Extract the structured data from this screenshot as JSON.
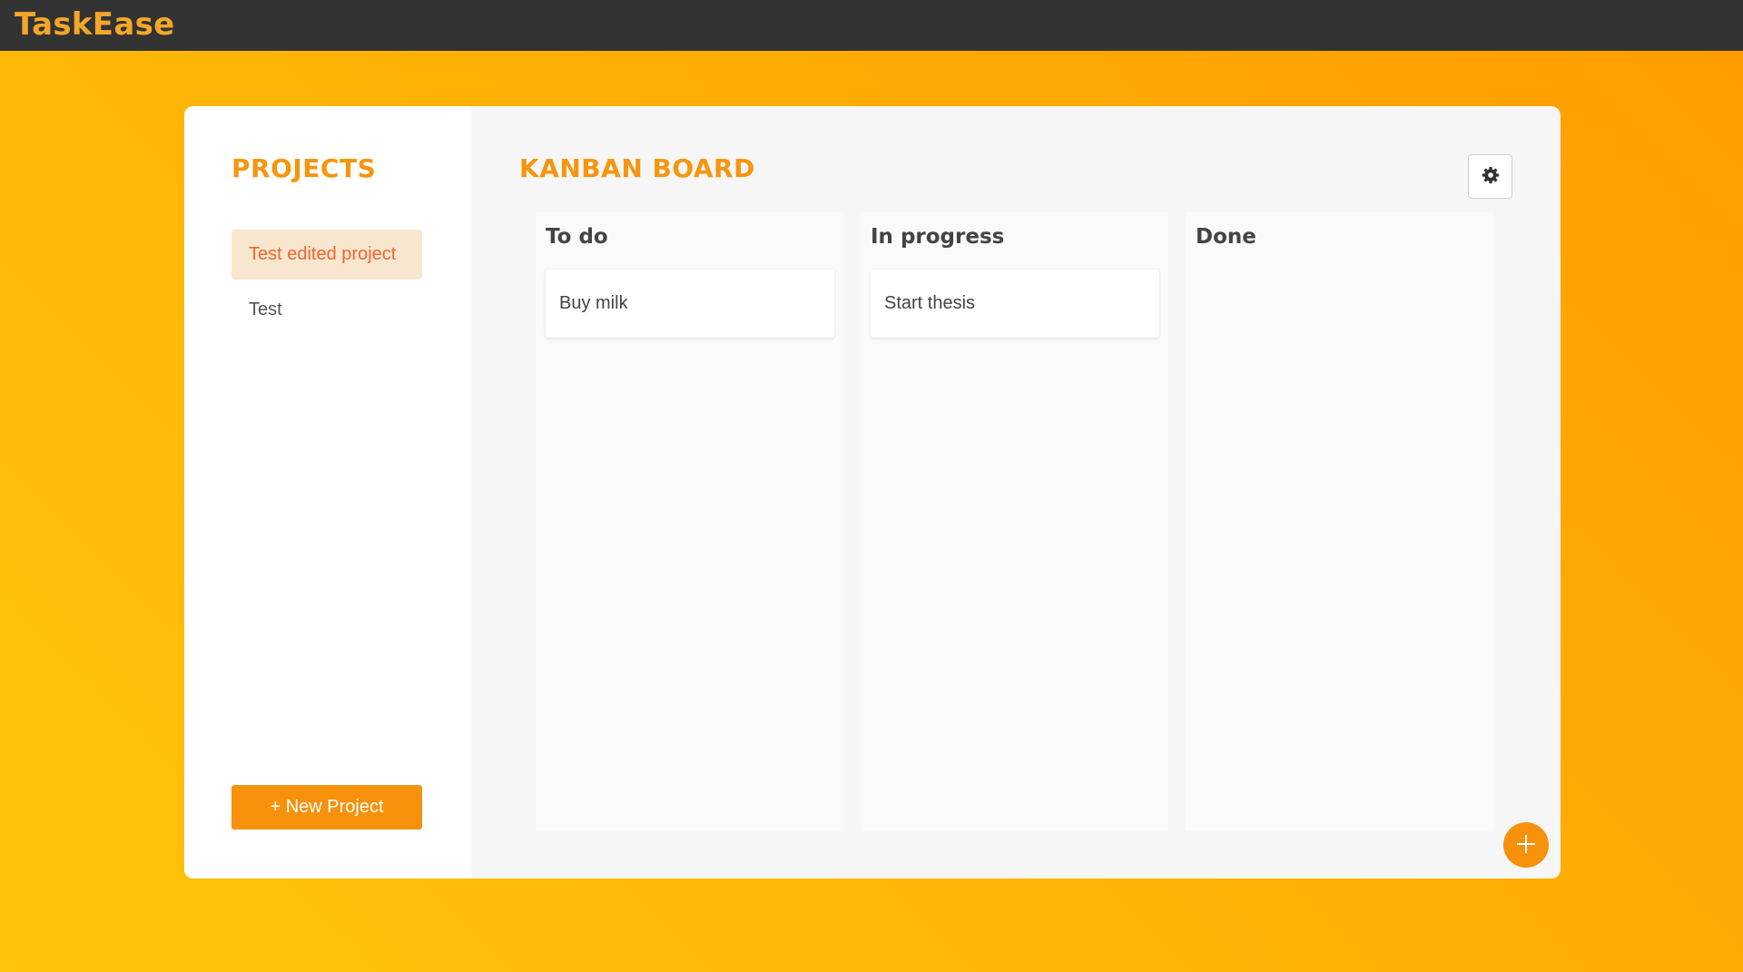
{
  "app": {
    "name": "TaskEase"
  },
  "sidebar": {
    "title": "PROJECTS",
    "projects": [
      {
        "name": "Test edited project",
        "active": true
      },
      {
        "name": "Test",
        "active": false
      }
    ],
    "new_project_label": "+ New Project"
  },
  "board": {
    "title": "KANBAN BOARD",
    "settings_icon": "gear-icon",
    "columns": [
      {
        "title": "To do",
        "cards": [
          "Buy milk"
        ]
      },
      {
        "title": "In progress",
        "cards": [
          "Start thesis"
        ]
      },
      {
        "title": "Done",
        "cards": []
      }
    ],
    "add_icon": "plus-icon"
  },
  "colors": {
    "accent": "#f7910b",
    "topbar": "#333333",
    "brand": "#f4a62a",
    "active_project_bg": "#f9e6cf",
    "active_project_text": "#f0652c"
  }
}
